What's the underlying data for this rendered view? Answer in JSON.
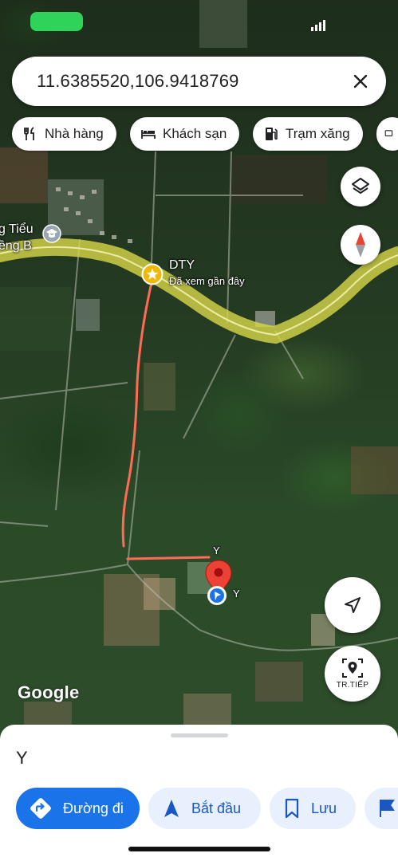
{
  "status_bar": {
    "battery_color": "#2fd35a"
  },
  "search": {
    "value": "11.6385520,106.9418769",
    "close_icon": "close-icon"
  },
  "chips": [
    {
      "label": "Nhà hàng",
      "icon": "restaurant-icon"
    },
    {
      "label": "Khách sạn",
      "icon": "hotel-icon"
    },
    {
      "label": "Trạm xăng",
      "icon": "gas-station-icon"
    }
  ],
  "map": {
    "labels": {
      "school_line1": "g Tiểu",
      "school_line2": "ềng B",
      "place_name": "DTY",
      "place_sub": "Đã xem gần đây",
      "pin_label_top": "Y",
      "pin_label_side": "Y"
    },
    "buttons": {
      "layers": "layers-icon",
      "compass": "compass-icon",
      "my_location": "navigation-arrow-icon",
      "live_view_label": "TR.TIẾP"
    },
    "logo": "Google",
    "colors": {
      "route": "#ff6b57",
      "pin": "#ea4335",
      "road_highlight": "#d8d84a"
    }
  },
  "sheet": {
    "title": "Y",
    "actions": [
      {
        "label": "Đường đi",
        "icon": "directions-icon",
        "style": "primary"
      },
      {
        "label": "Bắt đầu",
        "icon": "navigation-start-icon",
        "style": "secondary"
      },
      {
        "label": "Lưu",
        "icon": "bookmark-icon",
        "style": "secondary"
      }
    ]
  }
}
